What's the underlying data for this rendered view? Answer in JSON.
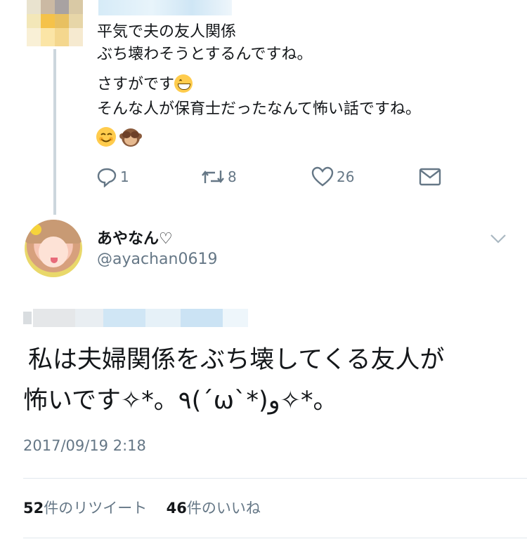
{
  "reply": {
    "line1": "平気で夫の友人関係",
    "line2": "ぶち壊わそうとするんですね。",
    "line3": "さすがです",
    "line4": "そんな人が保育士だったなんて怖い話ですね。",
    "line3_emoji": "grinning-face-with-smiling-eyes",
    "line5_emojis": [
      "smiling-face-emoji",
      "see-no-evil-monkey-emoji"
    ],
    "actions": {
      "reply_count": "1",
      "retweet_count": "8",
      "like_count": "26"
    }
  },
  "tweet": {
    "display_name": "あやなん♡",
    "handle": "@ayachan0619",
    "text_line1": "私は夫婦関係をぶち壊してくる友人が",
    "text_line2": "怖いです✧*。٩(ˊωˋ*)و✧*。",
    "timestamp": "2017/09/19 2:18",
    "retweets_count": "52",
    "retweets_label": "件のリツイート",
    "likes_count": "46",
    "likes_label": "件のいいね"
  },
  "colors": {
    "text": "#14171a",
    "secondary": "#657786",
    "divider": "#e1e8ed",
    "thread_line": "#ccd6dd",
    "blur_blue": "#cfe6f5"
  }
}
